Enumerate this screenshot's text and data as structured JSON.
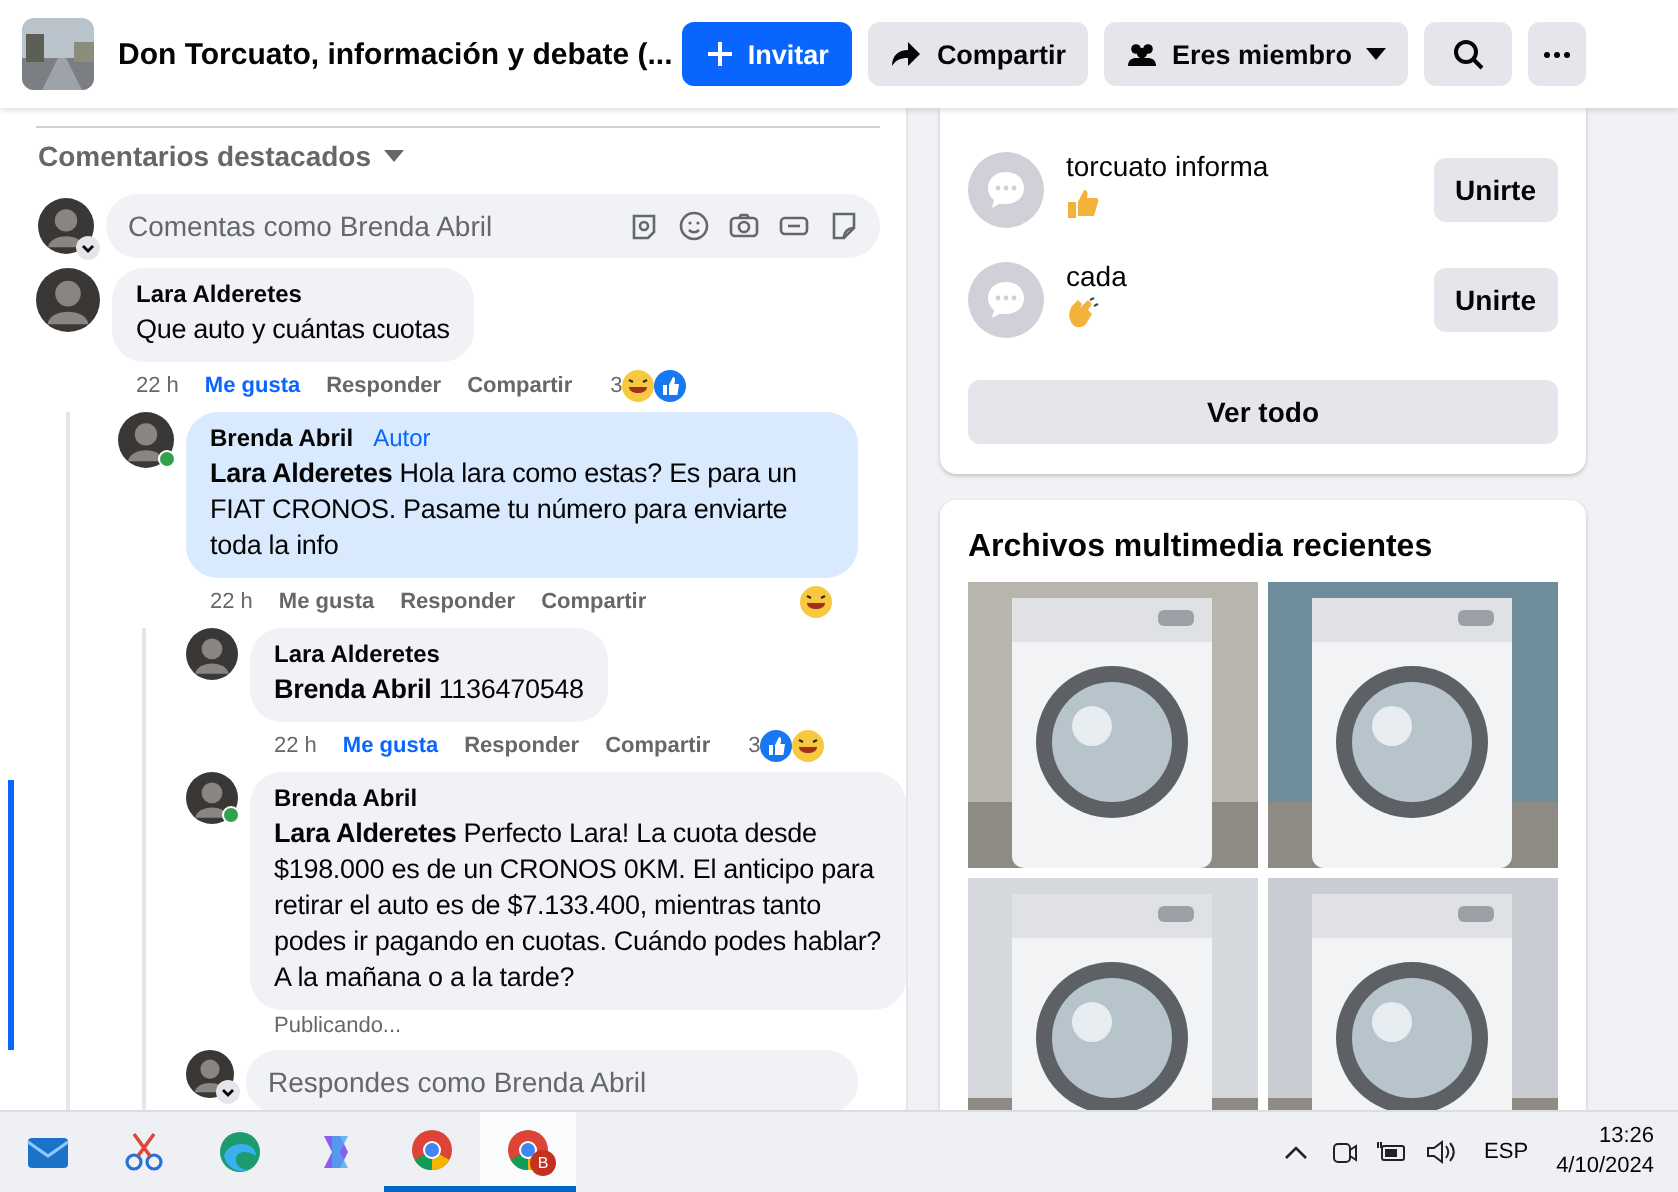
{
  "header": {
    "title": "Don Torcuato, información y debate (...",
    "buttons": [
      {
        "kind": "invite",
        "label": "Invitar"
      },
      {
        "kind": "share",
        "label": "Compartir"
      },
      {
        "kind": "membership",
        "label": "Eres miembro",
        "dropdown": true
      },
      {
        "kind": "search"
      },
      {
        "kind": "more"
      }
    ]
  },
  "comments": {
    "sort_label": "Comentarios destacados",
    "composer": {
      "placeholder": "Comentas como Brenda Abril"
    },
    "items": [
      {
        "author": "Lara Alderetes",
        "online": false,
        "highlighted": false,
        "text": "Que auto y cuántas cuotas",
        "time": "22 h",
        "actions": [
          {
            "label": "Me gusta",
            "active": true
          },
          {
            "label": "Responder",
            "active": false
          },
          {
            "label": "Compartir",
            "active": false
          }
        ],
        "reaction_count": "3",
        "reactions": [
          {
            "kind": "haha"
          },
          {
            "kind": "like"
          }
        ],
        "children": [
          {
            "author": "Brenda Abril",
            "badge": "Autor",
            "online": true,
            "highlighted": true,
            "text": "**Lara Alderetes** Hola lara como estas? Es para un FIAT CRONOS. Pasame tu número para enviarte toda la info",
            "time": "22 h",
            "actions": [
              {
                "label": "Me gusta",
                "active": false
              },
              {
                "label": "Responder",
                "active": false
              },
              {
                "label": "Compartir",
                "active": false
              }
            ],
            "reactions": [
              {
                "kind": "haha"
              }
            ],
            "children": [
              {
                "author": "Lara Alderetes",
                "online": false,
                "highlighted": false,
                "text": "**Brenda Abril** 1136470548",
                "time": "22 h",
                "actions": [
                  {
                    "label": "Me gusta",
                    "active": true
                  },
                  {
                    "label": "Responder",
                    "active": false
                  },
                  {
                    "label": "Compartir",
                    "active": false
                  }
                ],
                "reaction_count": "3",
                "reactions": [
                  {
                    "kind": "like"
                  },
                  {
                    "kind": "haha"
                  }
                ]
              },
              {
                "author": "Brenda Abril",
                "online": true,
                "highlighted": false,
                "text": "**Lara Alderetes** Perfecto Lara! La cuota desde $198.000 es de un CRONOS 0KM. El anticipo para retirar el auto es de $7.133.400, mientras tanto podes ir pagando en cuotas. Cuándo podes hablar? A la mañana o a la tarde?",
                "status": "Publicando..."
              }
            ],
            "reply_field": {
              "placeholder": "Respondes como Brenda Abril"
            }
          }
        ]
      }
    ]
  },
  "chats": {
    "items": [
      {
        "name": "torcuato informa",
        "button": "Unirte"
      },
      {
        "name": "cada",
        "button": "Unirte"
      }
    ],
    "see_all": "Ver todo"
  },
  "media": {
    "title": "Archivos multimedia recientes"
  },
  "taskbar": {
    "apps": [
      {
        "kind": "mail",
        "running": false,
        "selected": false
      },
      {
        "kind": "snipping",
        "running": false,
        "selected": false
      },
      {
        "kind": "browser",
        "running": false,
        "selected": false
      },
      {
        "kind": "assistant",
        "running": false,
        "selected": false
      },
      {
        "kind": "chrome",
        "running": true,
        "selected": false
      },
      {
        "kind": "chrome",
        "running": true,
        "selected": true,
        "badge": "B"
      }
    ],
    "language": "ESP",
    "time": "13:26",
    "date": "4/10/2024"
  }
}
